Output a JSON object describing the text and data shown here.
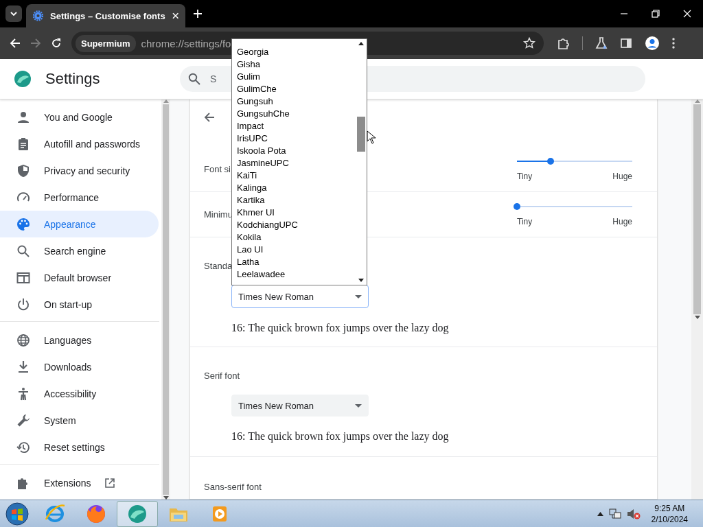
{
  "tabs": [
    {
      "title": "Settings – Customise fonts",
      "selected": true
    }
  ],
  "toolbar": {
    "chip": "Supermium",
    "url": "chrome://settings/fo"
  },
  "header": {
    "title": "Settings",
    "search_placeholder": "S"
  },
  "sidebar": {
    "groups": [
      [
        {
          "label": "You and Google",
          "selected": false
        },
        {
          "label": "Autofill and passwords",
          "selected": false
        },
        {
          "label": "Privacy and security",
          "selected": false
        },
        {
          "label": "Performance",
          "selected": false
        },
        {
          "label": "Appearance",
          "selected": true
        },
        {
          "label": "Search engine",
          "selected": false
        },
        {
          "label": "Default browser",
          "selected": false
        },
        {
          "label": "On start-up",
          "selected": false
        }
      ],
      [
        {
          "label": "Languages",
          "selected": false
        },
        {
          "label": "Downloads",
          "selected": false
        },
        {
          "label": "Accessibility",
          "selected": false
        },
        {
          "label": "System",
          "selected": false
        },
        {
          "label": "Reset settings",
          "selected": false
        }
      ],
      [
        {
          "label": "Extensions",
          "selected": false,
          "external": true
        }
      ]
    ]
  },
  "font_settings": {
    "rows": [
      {
        "kind": "slider",
        "label": "Font si",
        "level": 0.29,
        "min_label": "Tiny",
        "max_label": "Huge"
      },
      {
        "kind": "slider",
        "label": "Minimu",
        "level": 0,
        "min_label": "Tiny",
        "max_label": "Huge"
      },
      {
        "kind": "font",
        "label": "Standa",
        "value": "Times New Roman",
        "open": true,
        "sample": "16: The quick brown fox jumps over the lazy dog"
      },
      {
        "kind": "font",
        "label": "Serif font",
        "value": "Times New Roman",
        "open": false,
        "sample": "16: The quick brown fox jumps over the lazy dog"
      },
      {
        "kind": "heading",
        "label": "Sans-serif font"
      }
    ]
  },
  "dropdown": {
    "options": [
      "Georgia",
      "Gisha",
      "Gulim",
      "GulimChe",
      "Gungsuh",
      "GungsuhChe",
      "Impact",
      "IrisUPC",
      "Iskoola Pota",
      "JasmineUPC",
      "KaiTi",
      "Kalinga",
      "Kartika",
      "Khmer UI",
      "KodchiangUPC",
      "Kokila",
      "Lao UI",
      "Latha",
      "Leelawadee"
    ]
  },
  "taskbar": {
    "time": "9:25 AM",
    "date": "2/10/2024"
  }
}
